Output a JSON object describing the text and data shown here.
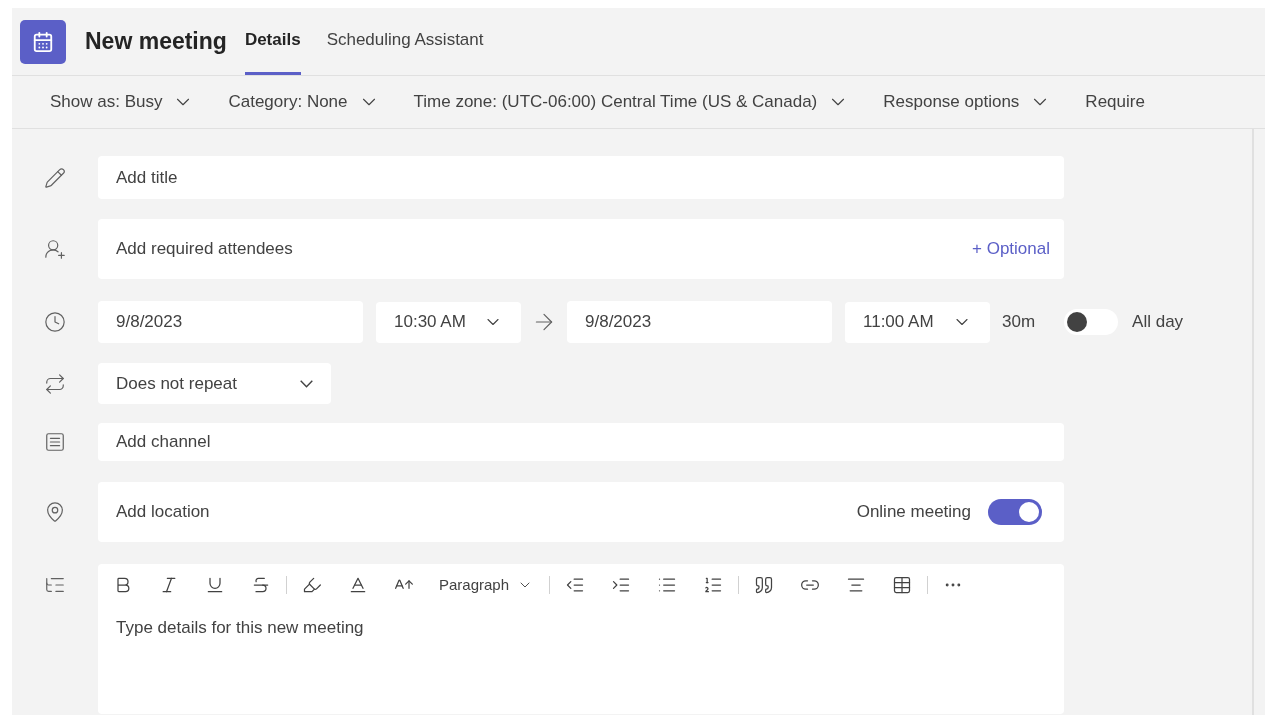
{
  "header": {
    "title": "New meeting",
    "tabs": [
      {
        "label": "Details",
        "selected": true
      },
      {
        "label": "Scheduling Assistant",
        "selected": false
      }
    ]
  },
  "options": [
    {
      "label": "Show as: Busy",
      "dropdown": true
    },
    {
      "label": "Category: None",
      "dropdown": true
    },
    {
      "label": "Time zone: (UTC-06:00) Central Time (US & Canada)",
      "dropdown": true
    },
    {
      "label": "Response options",
      "dropdown": true
    },
    {
      "label": "Require",
      "dropdown": false
    }
  ],
  "form": {
    "title_placeholder": "Add title",
    "attendees_placeholder": "Add required attendees",
    "optional_link": "+ Optional",
    "start_date": "9/8/2023",
    "start_time": "10:30 AM",
    "end_date": "9/8/2023",
    "end_time": "11:00 AM",
    "duration": "30m",
    "all_day": {
      "label": "All day",
      "on": false
    },
    "repeat": "Does not repeat",
    "channel_placeholder": "Add channel",
    "location_placeholder": "Add location",
    "online_meeting": {
      "label": "Online meeting",
      "on": true
    },
    "editor": {
      "paragraph_style": "Paragraph",
      "placeholder": "Type details for this new meeting"
    }
  }
}
